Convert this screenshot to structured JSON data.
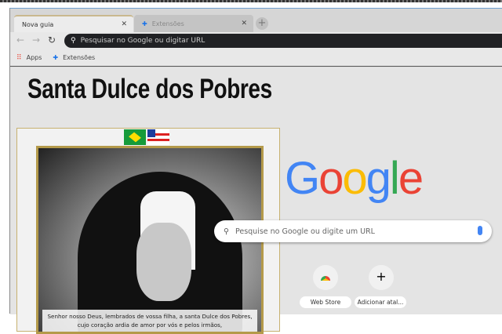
{
  "tabs": [
    {
      "label": "Nova guia",
      "close": "✕"
    },
    {
      "label": "Extensões",
      "close": "✕"
    }
  ],
  "new_tab": "+",
  "omnibox": {
    "placeholder": "Pesquisar no Google ou digitar URL"
  },
  "bookmarks": [
    {
      "label": "Apps"
    },
    {
      "label": "Extensões"
    }
  ],
  "page": {
    "title": "Santa Dulce dos Pobres",
    "prayer_line1": "Senhor nosso Deus, lembrados de vossa filha, a santa Dulce dos Pobres,",
    "prayer_line2": "cujo coração ardia de amor por vós e pelos irmãos,"
  },
  "google": {
    "letters": [
      "G",
      "o",
      "o",
      "g",
      "l",
      "e"
    ],
    "colors": [
      "#4285f4",
      "#ea4335",
      "#fbbc05",
      "#4285f4",
      "#34a853",
      "#ea4335"
    ],
    "search_placeholder": "Pesquise no Google ou digite um URL"
  },
  "shortcuts": [
    {
      "label": "Web Store"
    },
    {
      "label": "Adicionar atal..."
    }
  ],
  "add_icon": "+"
}
